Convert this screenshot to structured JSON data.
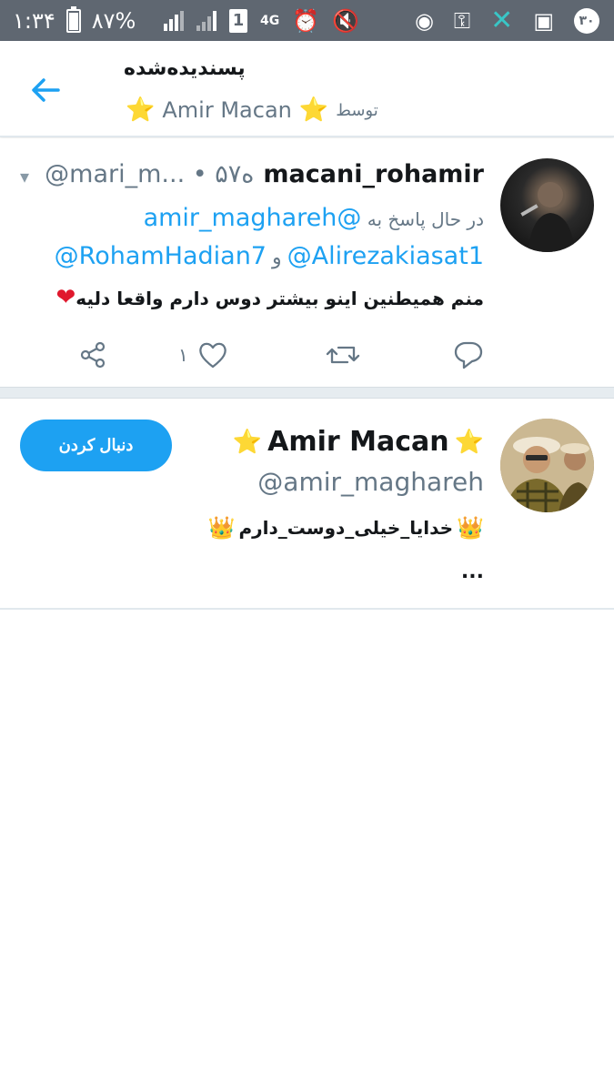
{
  "status_bar": {
    "time": "۱:۳۴",
    "battery": "۸۷%",
    "sim": "1",
    "network": "4G",
    "notification_count": "۳۰"
  },
  "header": {
    "title": "پسندیده‌شده",
    "by_label": "توسط",
    "user_name": "Amir Macan",
    "star": "⭐"
  },
  "tweet": {
    "display_name": "macani_rohamir",
    "handle_time": "@mari_m... • ۵۷ه",
    "reply_label": "در حال پاسخ به",
    "reply_mention": "@amir_maghareh",
    "mention_1": "@RohamHadian7",
    "and": "و",
    "mention_2": "@Alirezakiasat1",
    "text": "منم همیطنین اینو بیشتر دوس دارم واقعا دلیه",
    "heart_emoji": "❤",
    "like_count": "۱"
  },
  "user_card": {
    "display_name": "Amir Macan",
    "star": "⭐",
    "handle": "@amir_maghareh",
    "bio": "خدایا_خیلی_دوست_دارم",
    "crown": "👑",
    "more": "...",
    "follow_label": "دنبال کردن"
  },
  "colors": {
    "accent": "#1da1f2",
    "status_bar": "#5f6771",
    "muted": "#657786",
    "text": "#14171a"
  },
  "icons": [
    "back-arrow-icon",
    "chevron-down-icon",
    "reply-icon",
    "retweet-icon",
    "like-icon",
    "share-icon"
  ]
}
